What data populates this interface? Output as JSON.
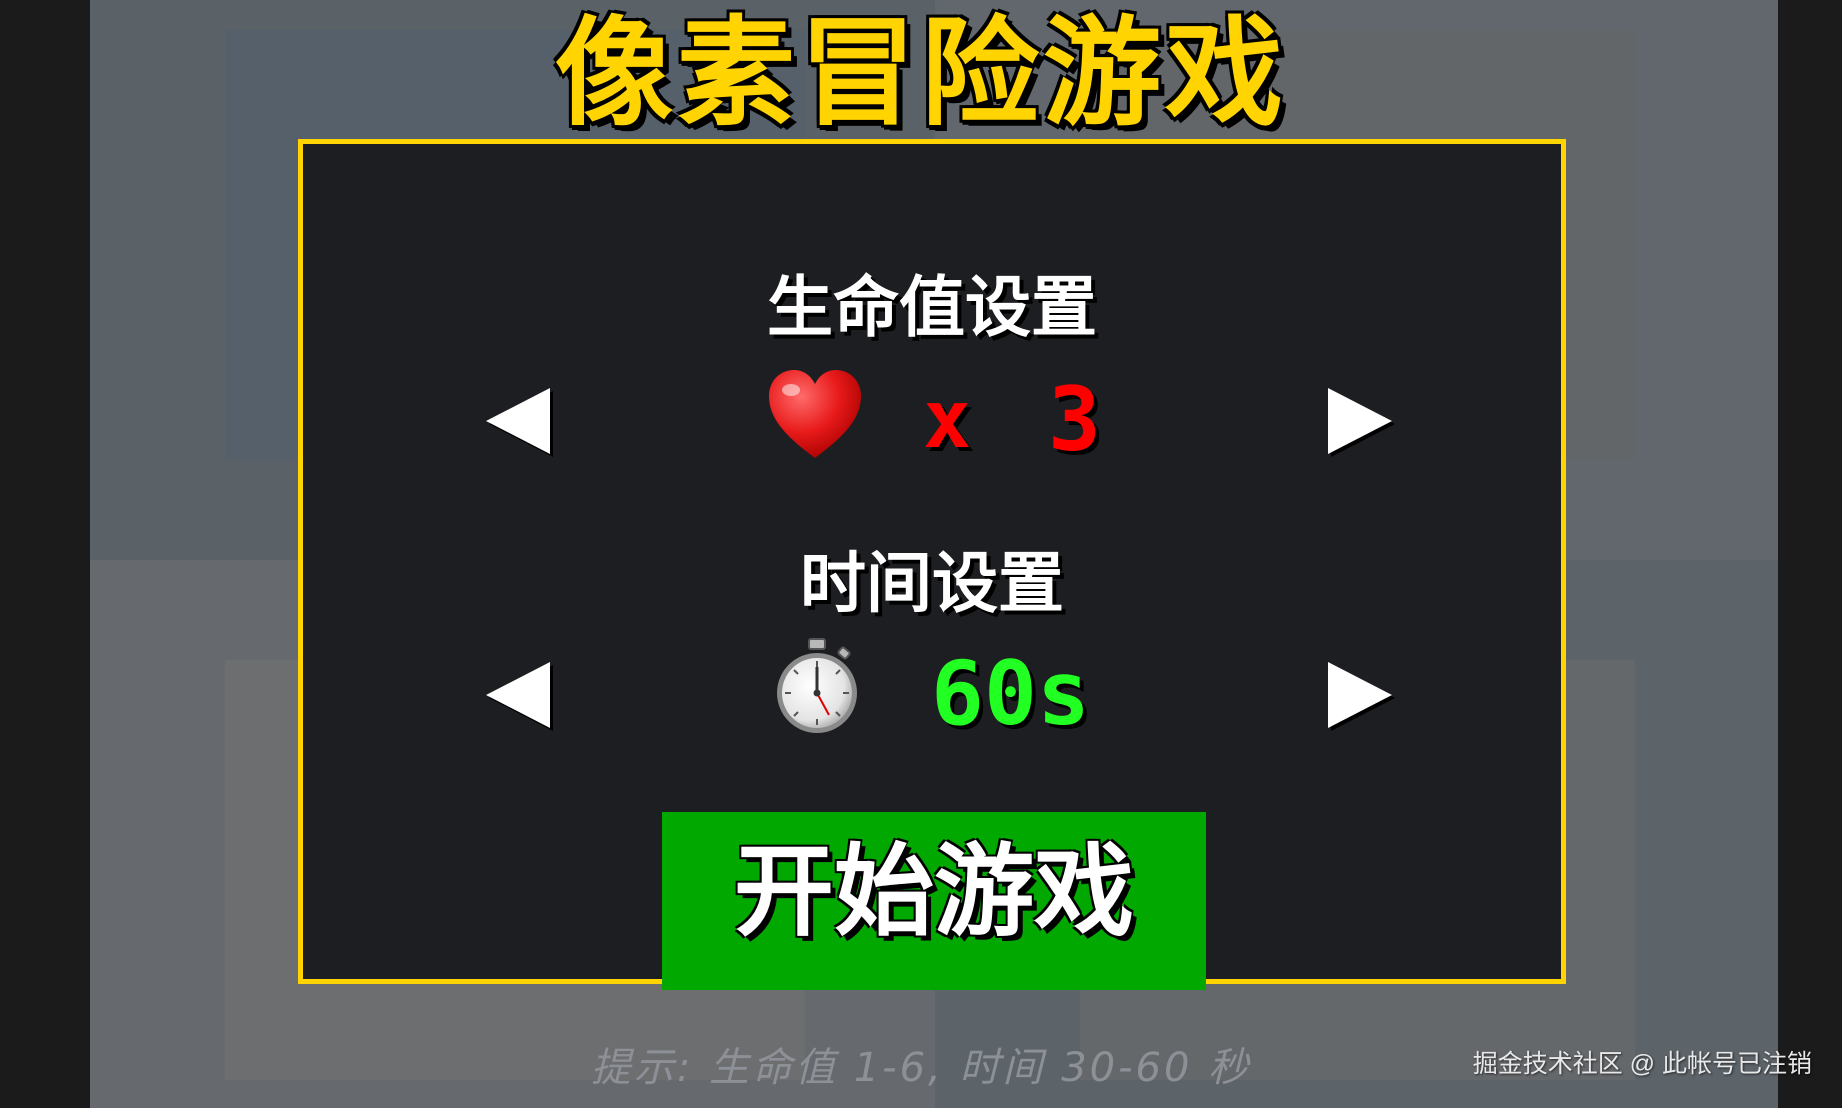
{
  "game": {
    "title": "像素冒险游戏",
    "title_color": "#ffd400",
    "panel_border_color": "#ffd400"
  },
  "settings": {
    "lives": {
      "label": "生命值设置",
      "icon": "heart-icon",
      "multiplier": "x",
      "value": "3",
      "color": "#ff0000",
      "prev_icon": "triangle-left-icon",
      "next_icon": "triangle-right-icon"
    },
    "time": {
      "label": "时间设置",
      "icon": "stopwatch-icon",
      "value": "60s",
      "color": "#22ff22",
      "prev_icon": "triangle-left-icon",
      "next_icon": "triangle-right-icon"
    }
  },
  "start_button": {
    "label": "开始游戏",
    "color": "#00a800"
  },
  "hint": "提示: 生命值 1-6, 时间 30-60 秒",
  "watermark": "掘金技术社区 @ 此帐号已注销"
}
